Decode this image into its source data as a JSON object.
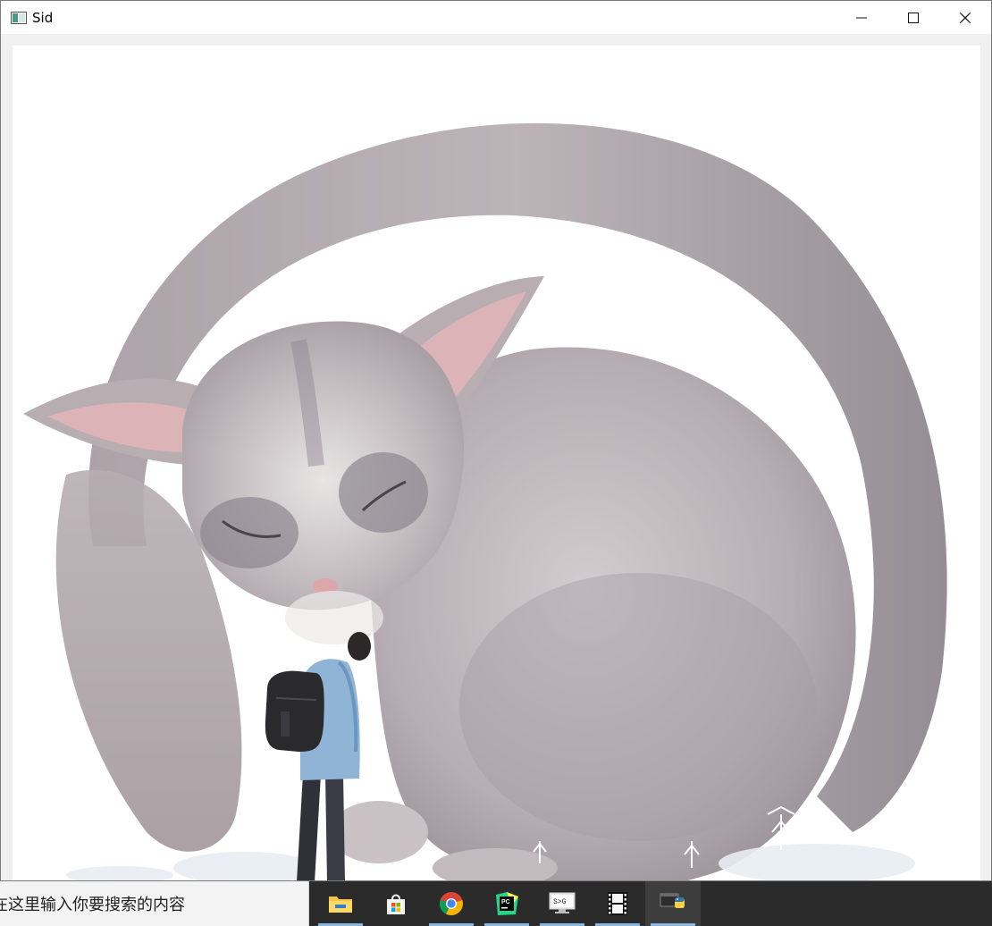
{
  "window": {
    "title": "Sid",
    "controls": {
      "minimize_glyph": "—",
      "maximize_glyph": "☐",
      "close_glyph": "✕"
    }
  },
  "image": {
    "subject": "illustration of a giant sleeping sugar glider curled with a bushy tail, a small person with a backpack standing beside it"
  },
  "taskbar": {
    "search_placeholder": "在这里输入你要搜索的内容",
    "apps": [
      {
        "name": "file-explorer-icon",
        "running": true,
        "active": false
      },
      {
        "name": "microsoft-store-icon",
        "running": false,
        "active": false
      },
      {
        "name": "chrome-icon",
        "running": true,
        "active": false
      },
      {
        "name": "pycharm-icon",
        "running": true,
        "active": false
      },
      {
        "name": "terminal-icon",
        "running": true,
        "active": false
      },
      {
        "name": "film-icon",
        "running": true,
        "active": false
      },
      {
        "name": "python-icon",
        "running": true,
        "active": true
      }
    ]
  },
  "colors": {
    "fur": "#b9b1b3",
    "fur_dark": "#8d8690",
    "ear_pink": "#e2b5b8",
    "jacket": "#8fb4d6",
    "backpack": "#2a2a2c"
  }
}
